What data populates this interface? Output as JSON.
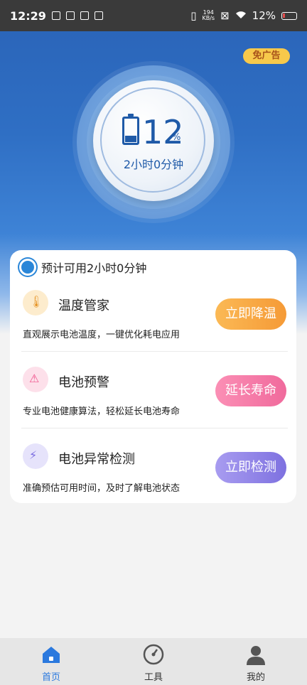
{
  "status_bar": {
    "time": "12:29",
    "net_speed_value": "194",
    "net_speed_unit": "KB/s",
    "battery_percent": "12%"
  },
  "header": {
    "ad_badge": "免广告"
  },
  "gauge": {
    "percent": "12",
    "percent_sign": "%",
    "remaining": "2小时0分钟",
    "battery_level": 0.12
  },
  "card": {
    "estimate_text": "预计可用2小时0分钟",
    "items": [
      {
        "title": "温度管家",
        "description": "直观展示电池温度，一键优化耗电应用",
        "button": "立即降温",
        "icon": "thermometer-icon",
        "button_color": "#f7a640"
      },
      {
        "title": "电池预警",
        "description": "专业电池健康算法，轻松延长电池寿命",
        "button": "延长寿命",
        "icon": "alarm-icon",
        "button_color": "#f67aa8"
      },
      {
        "title": "电池异常检测",
        "description": "准确预估可用时间，及时了解电池状态",
        "button": "立即检测",
        "icon": "battery-bolt-icon",
        "button_color": "#8f7fe8"
      }
    ]
  },
  "tabbar": {
    "tabs": [
      {
        "label": "首页",
        "icon": "home-icon",
        "active": true
      },
      {
        "label": "工具",
        "icon": "gauge-icon",
        "active": false
      },
      {
        "label": "我的",
        "icon": "person-icon",
        "active": false
      }
    ],
    "accent_color": "#2b79de"
  }
}
